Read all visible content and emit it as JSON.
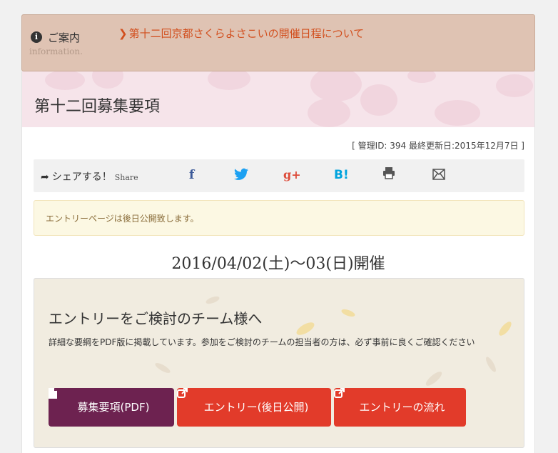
{
  "info": {
    "icon": "info-circle-icon",
    "title": "ご案内",
    "subtitle": "information.",
    "link_icon": "chevron-right-icon",
    "link_text": "第十二回京都さくらよさこいの開催日程について"
  },
  "page": {
    "title": "第十二回募集要項",
    "meta": "[ 管理ID: 394  最終更新日:2015年12月7日 ]"
  },
  "share": {
    "label": "シェアする！",
    "label_en": "Share",
    "icons": [
      {
        "name": "facebook-icon",
        "glyph": "f",
        "color": "#3b5998"
      },
      {
        "name": "twitter-icon",
        "glyph": "🐦",
        "color": "#1da1f2"
      },
      {
        "name": "google-plus-icon",
        "glyph": "g+",
        "color": "#dd4b39"
      },
      {
        "name": "hatena-bookmark-icon",
        "glyph": "B!",
        "color": "#00a4de"
      },
      {
        "name": "print-icon",
        "glyph": "⎙",
        "color": "#555555"
      },
      {
        "name": "mail-icon",
        "glyph": "✉",
        "color": "#555555"
      }
    ]
  },
  "alert": {
    "text": "エントリーページは後日公開致します。"
  },
  "event": {
    "date": "2016/04/02(土)～03(日)開催"
  },
  "entry": {
    "title": "エントリーをご検討のチーム様へ",
    "description": "詳細な要綱をPDF版に掲載しています。参加をご検討のチームの担当者の方は、必ず事前に良くご確認ください",
    "buttons": {
      "pdf": {
        "icon": "document-icon",
        "label": "募集要項(PDF)"
      },
      "entry": {
        "icon": "external-link-icon",
        "label": "エントリー(後日公開)"
      },
      "flow": {
        "icon": "external-link-icon",
        "label": "エントリーの流れ"
      }
    }
  },
  "colors": {
    "info_bg": "#dfc3b3",
    "link": "#d24f1e",
    "pdf_button": "#6d2250",
    "entry_button": "#e23b2a"
  }
}
